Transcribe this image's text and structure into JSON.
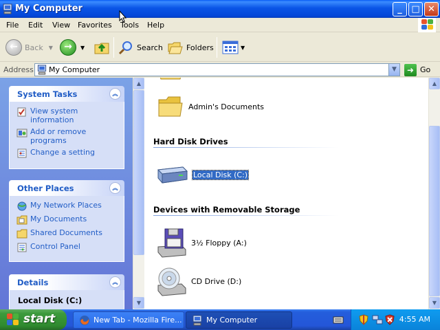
{
  "window": {
    "title": "My Computer",
    "controls": {
      "minimize": "_",
      "maximize": "□",
      "close": "✕"
    }
  },
  "menu": [
    "File",
    "Edit",
    "View",
    "Favorites",
    "Tools",
    "Help"
  ],
  "toolbar": {
    "back": "Back",
    "search": "Search",
    "folders": "Folders"
  },
  "address": {
    "label": "Address",
    "value": "My Computer",
    "go": "Go"
  },
  "sidebar": {
    "system_tasks": {
      "title": "System Tasks",
      "items": [
        "View system information",
        "Add or remove programs",
        "Change a setting"
      ]
    },
    "other_places": {
      "title": "Other Places",
      "items": [
        "My Network Places",
        "My Documents",
        "Shared Documents",
        "Control Panel"
      ]
    },
    "details": {
      "title": "Details",
      "name": "Local Disk (C:)"
    }
  },
  "main": {
    "top_folder": "Admin's Documents",
    "groups": [
      {
        "title": "Hard Disk Drives",
        "items": [
          "Local Disk (C:)"
        ]
      },
      {
        "title": "Devices with Removable Storage",
        "items": [
          "3½ Floppy (A:)",
          "CD Drive (D:)"
        ]
      }
    ]
  },
  "taskbar": {
    "start": "start",
    "tasks": [
      "New Tab - Mozilla Fire...",
      "My Computer"
    ],
    "clock": "4:55 AM"
  },
  "colors": {
    "titlebar": "#0A55E6",
    "sidebar_bg": "#6375D6",
    "link": "#215DC6",
    "selection": "#316AC5",
    "start": "#3C9A3C"
  }
}
